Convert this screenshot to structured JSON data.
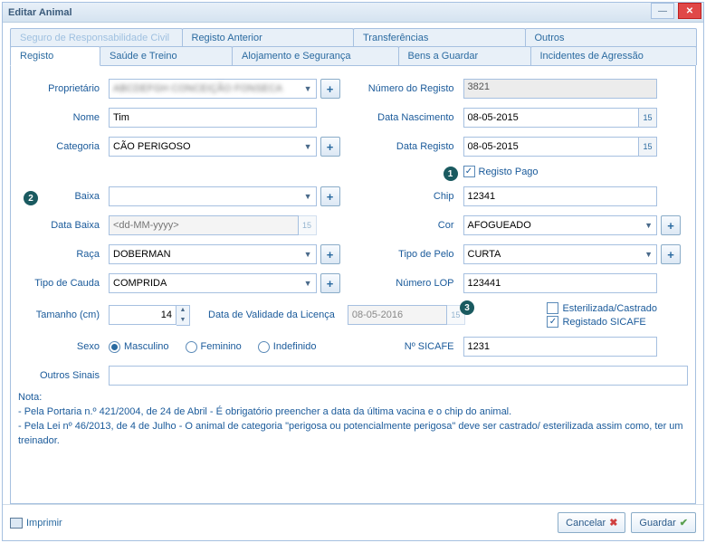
{
  "window": {
    "title": "Editar Animal"
  },
  "tabs_upper": [
    "Seguro de Responsabilidade Civil",
    "Registo Anterior",
    "Transferências",
    "Outros"
  ],
  "tabs_lower": [
    "Registo",
    "Saúde e Treino",
    "Alojamento e Segurança",
    "Bens a Guardar",
    "Incidentes de Agressão"
  ],
  "labels": {
    "proprietario": "Proprietário",
    "numero_registo": "Número do Registo",
    "nome": "Nome",
    "data_nasc": "Data Nascimento",
    "categoria": "Categoria",
    "data_registo": "Data Registo",
    "registo_pago": "Registo Pago",
    "baixa": "Baixa",
    "chip": "Chip",
    "data_baixa": "Data Baixa",
    "cor": "Cor",
    "raca": "Raça",
    "tipo_pelo": "Tipo de Pelo",
    "tipo_cauda": "Tipo de Cauda",
    "numero_lop": "Número LOP",
    "tamanho": "Tamanho (cm)",
    "data_validade": "Data de Validade da Licença",
    "esterilizada": "Esterilizada/Castrado",
    "sicafe": "Registado SICAFE",
    "sexo": "Sexo",
    "n_sicafe": "Nº SICAFE",
    "outros_sinais": "Outros Sinais"
  },
  "values": {
    "proprietario": "ABCDEFGH CONCEIÇÃO FONSECA",
    "numero_registo": "3821",
    "nome": "Tim",
    "data_nasc": "08-05-2015",
    "categoria": "CÃO PERIGOSO",
    "data_registo": "08-05-2015",
    "registo_pago": true,
    "baixa": "",
    "chip": "12341",
    "data_baixa_placeholder": "<dd-MM-yyyy>",
    "cor": "AFOGUEADO",
    "raca": "DOBERMAN",
    "tipo_pelo": "CURTA",
    "tipo_cauda": "COMPRIDA",
    "numero_lop": "123441",
    "tamanho": "14",
    "data_validade": "08-05-2016",
    "esterilizada": false,
    "sicafe": true,
    "n_sicafe": "1231",
    "outros_sinais": ""
  },
  "sexo": {
    "options": [
      "Masculino",
      "Feminino",
      "Indefinido"
    ],
    "selected": "Masculino"
  },
  "badges": {
    "b1": "1",
    "b2": "2",
    "b3": "3"
  },
  "nota": {
    "header": "Nota:",
    "l1": " - Pela Portaria n.º 421/2004, de 24 de Abril - É obrigatório preencher a data da última vacina e o chip do animal.",
    "l2": " - Pela Lei nº 46/2013, de 4 de Julho - O animal de categoria \"perigosa ou potencialmente perigosa\" deve ser castrado/ esterilizada assim como, ter um treinador."
  },
  "buttons": {
    "imprimir": "Imprimir",
    "cancelar": "Cancelar",
    "guardar": "Guardar"
  },
  "date_icon_text": "15"
}
